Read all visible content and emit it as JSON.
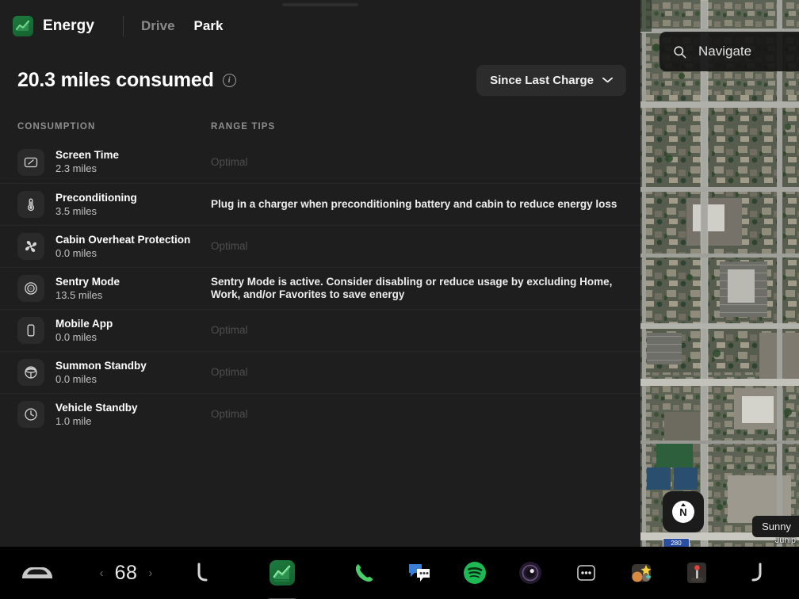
{
  "app": {
    "logo_icon": "energy-app-icon",
    "title": "Energy",
    "tabs": [
      {
        "label": "Drive",
        "active": false
      },
      {
        "label": "Park",
        "active": true
      }
    ]
  },
  "summary": {
    "value": "20.3 miles consumed",
    "info_icon": "info-icon",
    "filter_label": "Since Last Charge",
    "filter_chevron": "chevron-down-icon"
  },
  "columns": {
    "consumption": "CONSUMPTION",
    "range_tips": "RANGE TIPS"
  },
  "rows": [
    {
      "icon": "screen-icon",
      "name": "Screen Time",
      "value": "2.3 miles",
      "tip": "Optimal",
      "optimal": true
    },
    {
      "icon": "thermometer-icon",
      "name": "Preconditioning",
      "value": "3.5 miles",
      "tip": "Plug in a charger when preconditioning battery and cabin to reduce energy loss",
      "optimal": false
    },
    {
      "icon": "fan-icon",
      "name": "Cabin Overheat Protection",
      "value": "0.0 miles",
      "tip": "Optimal",
      "optimal": true
    },
    {
      "icon": "sentry-camera-icon",
      "name": "Sentry Mode",
      "value": "13.5 miles",
      "tip": "Sentry Mode is active. Consider disabling or reduce usage by excluding Home, Work, and/or Favorites to save energy",
      "optimal": false
    },
    {
      "icon": "phone-mobile-icon",
      "name": "Mobile App",
      "value": "0.0 miles",
      "tip": "Optimal",
      "optimal": true
    },
    {
      "icon": "steering-wheel-icon",
      "name": "Summon Standby",
      "value": "0.0 miles",
      "tip": "Optimal",
      "optimal": true
    },
    {
      "icon": "clock-icon",
      "name": "Vehicle Standby",
      "value": "1.0 mile",
      "tip": "Optimal",
      "optimal": true
    }
  ],
  "map": {
    "search_placeholder": "Navigate",
    "search_icon": "search-icon",
    "compass_label": "N",
    "compass_icon": "compass-icon",
    "weather": "Sunny",
    "street_label": "Junip",
    "route_shield": "280"
  },
  "dock": {
    "items": [
      {
        "icon": "car-icon",
        "label": ""
      },
      {
        "icon": "temp-decrease-icon",
        "label": "‹"
      },
      {
        "icon": "temperature-value",
        "label": "68"
      },
      {
        "icon": "temp-increase-icon",
        "label": "›"
      },
      {
        "icon": "seat-heater-left-icon",
        "label": ""
      },
      {
        "icon": "energy-app-icon",
        "label": ""
      },
      {
        "icon": "phone-icon",
        "label": ""
      },
      {
        "icon": "messages-icon",
        "label": ""
      },
      {
        "icon": "spotify-icon",
        "label": ""
      },
      {
        "icon": "dashcam-icon",
        "label": ""
      },
      {
        "icon": "toybox-icon",
        "label": ""
      },
      {
        "icon": "theater-icon",
        "label": ""
      },
      {
        "icon": "arcade-icon",
        "label": ""
      },
      {
        "icon": "seat-heater-right-icon",
        "label": ""
      }
    ]
  },
  "colors": {
    "panel_bg": "#1e1e1e",
    "dock_bg": "#000000",
    "accent_green": "#1d7a3e",
    "optimal_text": "#4e4e4e",
    "spotify_green": "#1db954",
    "messages_blue": "#3a7fd5"
  }
}
